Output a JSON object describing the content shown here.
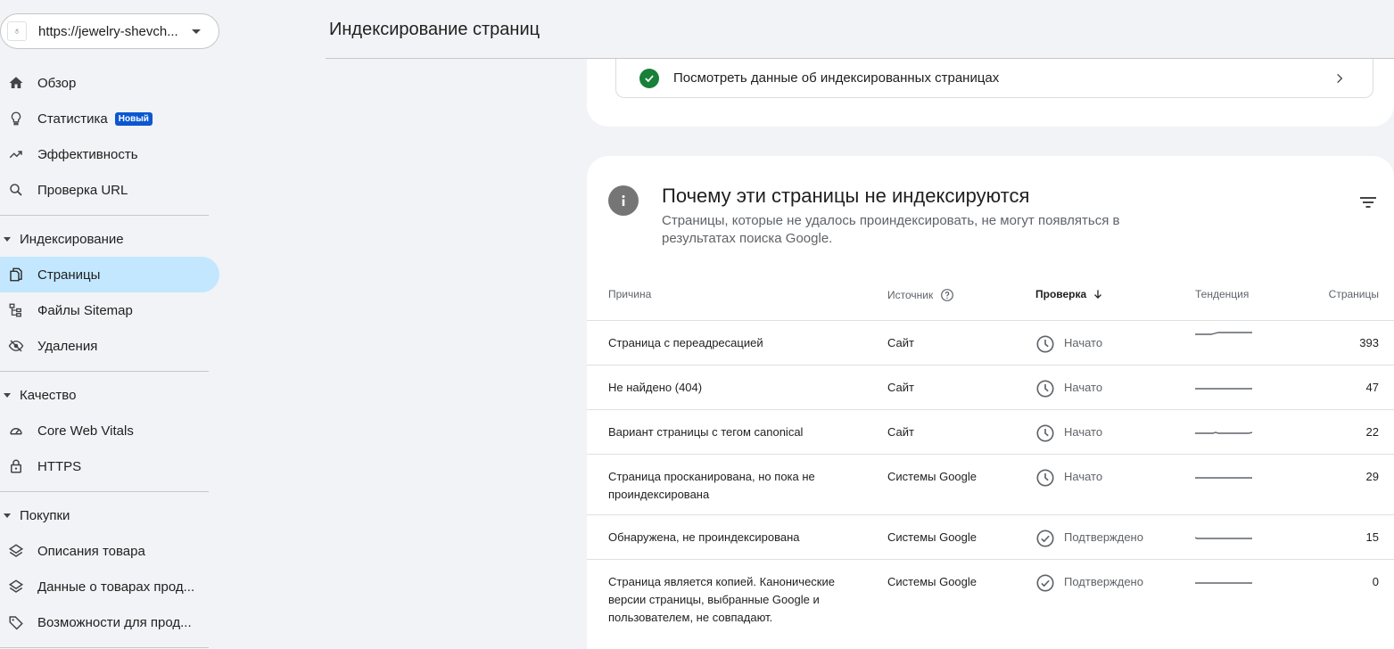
{
  "property": {
    "url": "https://jewelry-shevch..."
  },
  "sidebar": {
    "items": [
      {
        "label": "Обзор"
      },
      {
        "label": "Статистика",
        "badge": "Новый"
      },
      {
        "label": "Эффективность"
      },
      {
        "label": "Проверка URL"
      }
    ],
    "sections": [
      {
        "label": "Индексирование",
        "items": [
          {
            "label": "Страницы",
            "active": true
          },
          {
            "label": "Файлы Sitemap"
          },
          {
            "label": "Удаления"
          }
        ]
      },
      {
        "label": "Качество",
        "items": [
          {
            "label": "Core Web Vitals"
          },
          {
            "label": "HTTPS"
          }
        ]
      },
      {
        "label": "Покупки",
        "items": [
          {
            "label": "Описания товара"
          },
          {
            "label": "Данные о товарах прод..."
          },
          {
            "label": "Возможности для прод..."
          }
        ]
      }
    ]
  },
  "header": {
    "title": "Индексирование страниц"
  },
  "indexed_link": {
    "label": "Посмотреть данные об индексированных страницах"
  },
  "not_indexed": {
    "title": "Почему эти страницы не индексируются",
    "subtitle": "Страницы, которые не удалось проиндексировать, не могут появляться в результатах поиска Google.",
    "columns": {
      "reason": "Причина",
      "source": "Источник",
      "validation": "Проверка",
      "trend": "Тенденция",
      "pages": "Страницы"
    },
    "rows": [
      {
        "reason": "Страница с переадресацией",
        "source": "Сайт",
        "status": "Начато",
        "pages": "393"
      },
      {
        "reason": "Не найдено (404)",
        "source": "Сайт",
        "status": "Начато",
        "pages": "47"
      },
      {
        "reason": "Вариант страницы с тегом canonical",
        "source": "Сайт",
        "status": "Начато",
        "pages": "22"
      },
      {
        "reason": "Страница просканирована, но пока не проиндексирована",
        "source": "Системы Google",
        "status": "Начато",
        "pages": "29"
      },
      {
        "reason": "Обнаружена, не проиндексирована",
        "source": "Системы Google",
        "status": "Подтверждено",
        "pages": "15"
      },
      {
        "reason": "Страница является копией. Канонические версии страницы, выбранные Google и пользователем, не совпадают.",
        "source": "Системы Google",
        "status": "Подтверждено",
        "pages": "0"
      }
    ]
  },
  "colors": {
    "accent": "#0b57d0",
    "active_bg": "#c2e7ff",
    "success": "#188038"
  }
}
